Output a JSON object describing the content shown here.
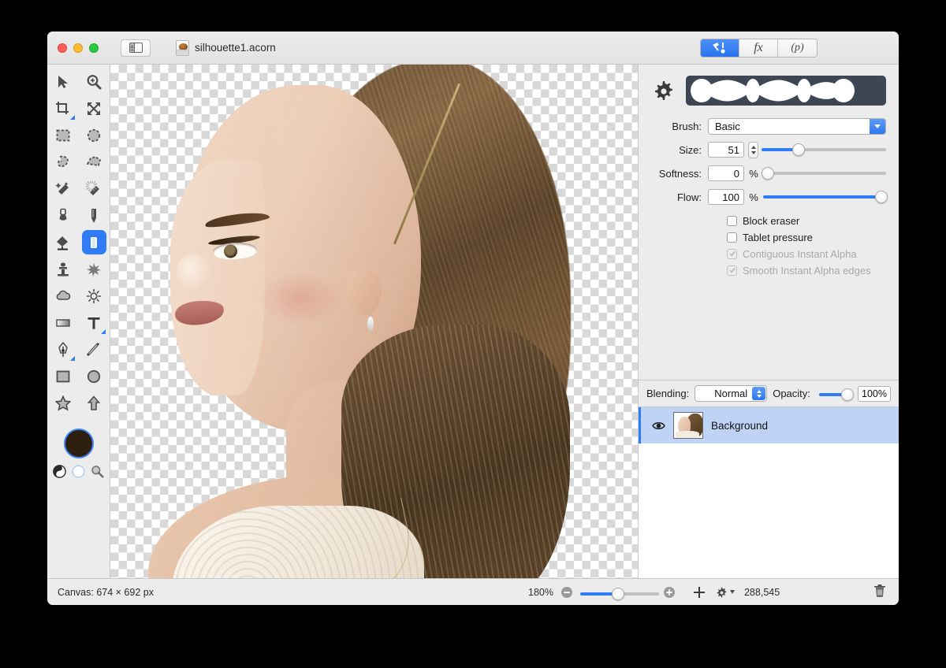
{
  "window": {
    "title": "silhouette1.acorn",
    "traffic_lights": [
      "close",
      "minimize",
      "maximize"
    ],
    "sidebar_toggle_icon": "sidebar-toggle-icon",
    "doc_icon": "acorn-document-icon"
  },
  "inspector_tabs": [
    {
      "id": "tools",
      "label": "",
      "icon": "hammer-pen-icon",
      "active": true
    },
    {
      "id": "filters",
      "label": "fx",
      "icon": "fx-icon",
      "active": false
    },
    {
      "id": "presets",
      "label": "(p)",
      "icon": "palette-p-icon",
      "active": false
    }
  ],
  "tools": {
    "rows": [
      [
        {
          "name": "move-tool",
          "icon": "arrow-cursor-icon",
          "active": false
        },
        {
          "name": "zoom-tool",
          "icon": "magnifier-plus-icon",
          "active": false
        }
      ],
      [
        {
          "name": "crop-tool",
          "icon": "crop-icon",
          "active": false,
          "badge": true
        },
        {
          "name": "transform-tool",
          "icon": "arrows-expand-icon",
          "active": false
        }
      ],
      [
        {
          "name": "rect-select-tool",
          "icon": "dashed-rectangle-icon",
          "active": false
        },
        {
          "name": "ellipse-select-tool",
          "icon": "dashed-circle-icon",
          "active": false
        }
      ],
      [
        {
          "name": "lasso-tool",
          "icon": "dashed-lasso-icon",
          "active": false
        },
        {
          "name": "polygon-select-tool",
          "icon": "dashed-polygon-icon",
          "active": false
        }
      ],
      [
        {
          "name": "magic-wand-tool",
          "icon": "magic-wand-icon",
          "active": false
        },
        {
          "name": "instant-alpha-tool",
          "icon": "magic-wand-dots-icon",
          "active": false
        }
      ],
      [
        {
          "name": "brush-tool",
          "icon": "paintbrush-icon",
          "active": false
        },
        {
          "name": "pencil-tool",
          "icon": "pencil-icon",
          "active": false
        }
      ],
      [
        {
          "name": "paint-bucket-tool",
          "icon": "paint-bucket-icon",
          "active": false
        },
        {
          "name": "eraser-tool",
          "icon": "eraser-icon",
          "active": true
        }
      ],
      [
        {
          "name": "clone-stamp-tool",
          "icon": "clone-stamp-icon",
          "active": false
        },
        {
          "name": "smudge-tool",
          "icon": "smudge-splat-icon",
          "active": false
        }
      ],
      [
        {
          "name": "blur-tool",
          "icon": "cloud-blur-icon",
          "active": false
        },
        {
          "name": "dodge-burn-tool",
          "icon": "sun-icon",
          "active": false
        }
      ],
      [
        {
          "name": "gradient-tool",
          "icon": "gradient-icon",
          "active": false
        },
        {
          "name": "text-tool",
          "icon": "text-T-icon",
          "active": false,
          "badge": true
        }
      ],
      [
        {
          "name": "bezier-pen-tool",
          "icon": "fountain-pen-icon",
          "active": false,
          "badge": true
        },
        {
          "name": "line-tool",
          "icon": "line-diagonal-icon",
          "active": false
        }
      ],
      [
        {
          "name": "rectangle-shape-tool",
          "icon": "square-icon",
          "active": false
        },
        {
          "name": "ellipse-shape-tool",
          "icon": "circle-icon",
          "active": false
        }
      ],
      [
        {
          "name": "star-shape-tool",
          "icon": "star-icon",
          "active": false
        },
        {
          "name": "arrow-shape-tool",
          "icon": "arrow-up-icon",
          "active": false
        }
      ]
    ],
    "color_well": {
      "name": "foreground-color-well",
      "color": "#2e1f10",
      "ring": "#3d86f2"
    },
    "mini_buttons": [
      {
        "name": "swap-colors-icon",
        "icon": "half-filled-circle-icon"
      },
      {
        "name": "default-colors-icon",
        "icon": "empty-circle-icon"
      },
      {
        "name": "color-picker-icon",
        "icon": "magnifier-icon"
      }
    ]
  },
  "brush_panel": {
    "gear_icon": "gear-icon",
    "stroke_preview_name": "brush-stroke-preview",
    "stroke_preview_bg": "#3e4553",
    "stroke_preview_fg": "#ffffff",
    "brush_label": "Brush:",
    "brush_value": "Basic",
    "size_label": "Size:",
    "size_value": "51",
    "size_slider_pct": 30,
    "softness_label": "Softness:",
    "softness_value": "0",
    "softness_unit": "%",
    "softness_slider_pct": 0,
    "flow_label": "Flow:",
    "flow_value": "100",
    "flow_unit": "%",
    "flow_slider_pct": 100,
    "checkboxes": [
      {
        "label": "Block eraser",
        "checked": false,
        "disabled": false
      },
      {
        "label": "Tablet pressure",
        "checked": false,
        "disabled": false
      },
      {
        "label": "Contiguous Instant Alpha",
        "checked": true,
        "disabled": true
      },
      {
        "label": "Smooth Instant Alpha edges",
        "checked": true,
        "disabled": true
      }
    ]
  },
  "layers_panel": {
    "blending_label": "Blending:",
    "blending_value": "Normal",
    "opacity_label": "Opacity:",
    "opacity_value": "100%",
    "opacity_slider_pct": 100,
    "layers": [
      {
        "name": "Background",
        "visible": true,
        "selected": true,
        "thumb": "portrait-thumbnail"
      }
    ]
  },
  "statusbar": {
    "canvas_label": "Canvas: 674 × 692 px",
    "zoom_label": "180%",
    "zoom_slider_pct": 48,
    "zoom_out_icon": "zoom-out-icon",
    "zoom_in_icon": "zoom-in-icon",
    "add_layer_icon": "plus-icon",
    "layer_actions_icon": "gear-dropdown-icon",
    "memory_label": "288,545",
    "trash_icon": "trash-icon"
  },
  "canvas": {
    "name": "image-canvas",
    "checkerboard": true,
    "image_description": "portrait-photo-of-woman-in-profile"
  },
  "colors": {
    "accent": "#2f7cf6",
    "window_bg": "#ececec",
    "selection_blue": "#bed3f5",
    "canvas_bg": "#b9b9b9"
  }
}
